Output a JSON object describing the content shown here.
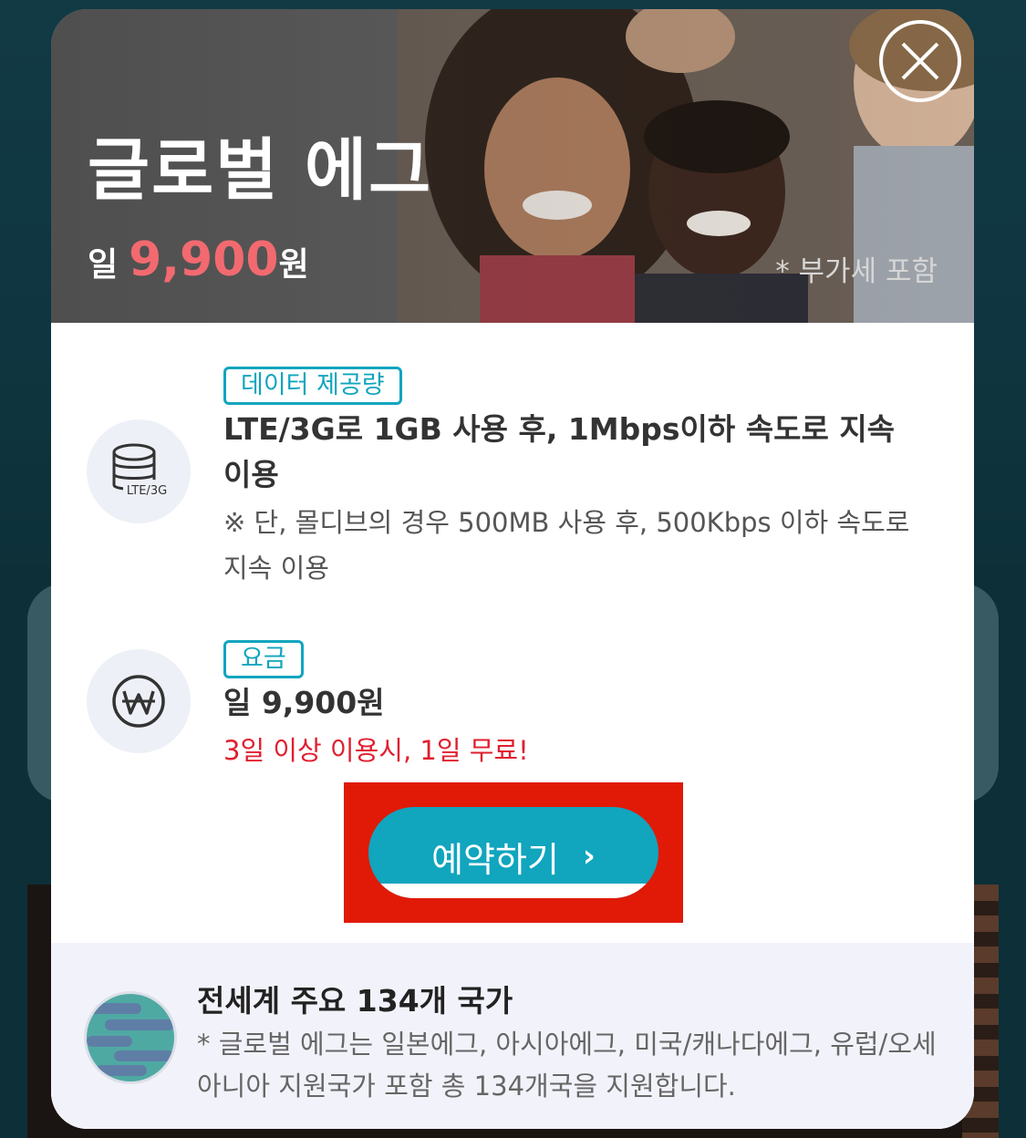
{
  "hero": {
    "title": "글로벌 에그",
    "price_prefix": "일",
    "price_amount": "9,900",
    "price_suffix": "원",
    "vat_note": "* 부가세 포함",
    "close_icon": "close-icon"
  },
  "data_section": {
    "icon": "database-icon",
    "icon_label": "LTE/3G",
    "tag": "데이터 제공량",
    "main": "LTE/3G로 1GB 사용 후, 1Mbps이하 속도로 지속 이용",
    "note": "※ 단, 몰디브의 경우 500MB 사용 후, 500Kbps 이하 속도로 지속 이용"
  },
  "fee_section": {
    "icon": "won-icon",
    "tag": "요금",
    "main": "일 9,900원",
    "promo": "3일 이상 이용시, 1일 무료!"
  },
  "booking": {
    "label": "예약하기",
    "chevron": "›"
  },
  "footer": {
    "icon": "globe-icon",
    "title": "전세계 주요 134개 국가",
    "note": "* 글로벌 에그는 일본에그, 아시아에그, 미국/캐나다에그, 유럽/오세아니아 지원국가 포함 총 134개국을 지원합니다."
  },
  "colors": {
    "accent": "#11a5be",
    "price_highlight": "#f26a6f",
    "promo": "#e01f2f",
    "highlight_box": "#e01a07"
  }
}
